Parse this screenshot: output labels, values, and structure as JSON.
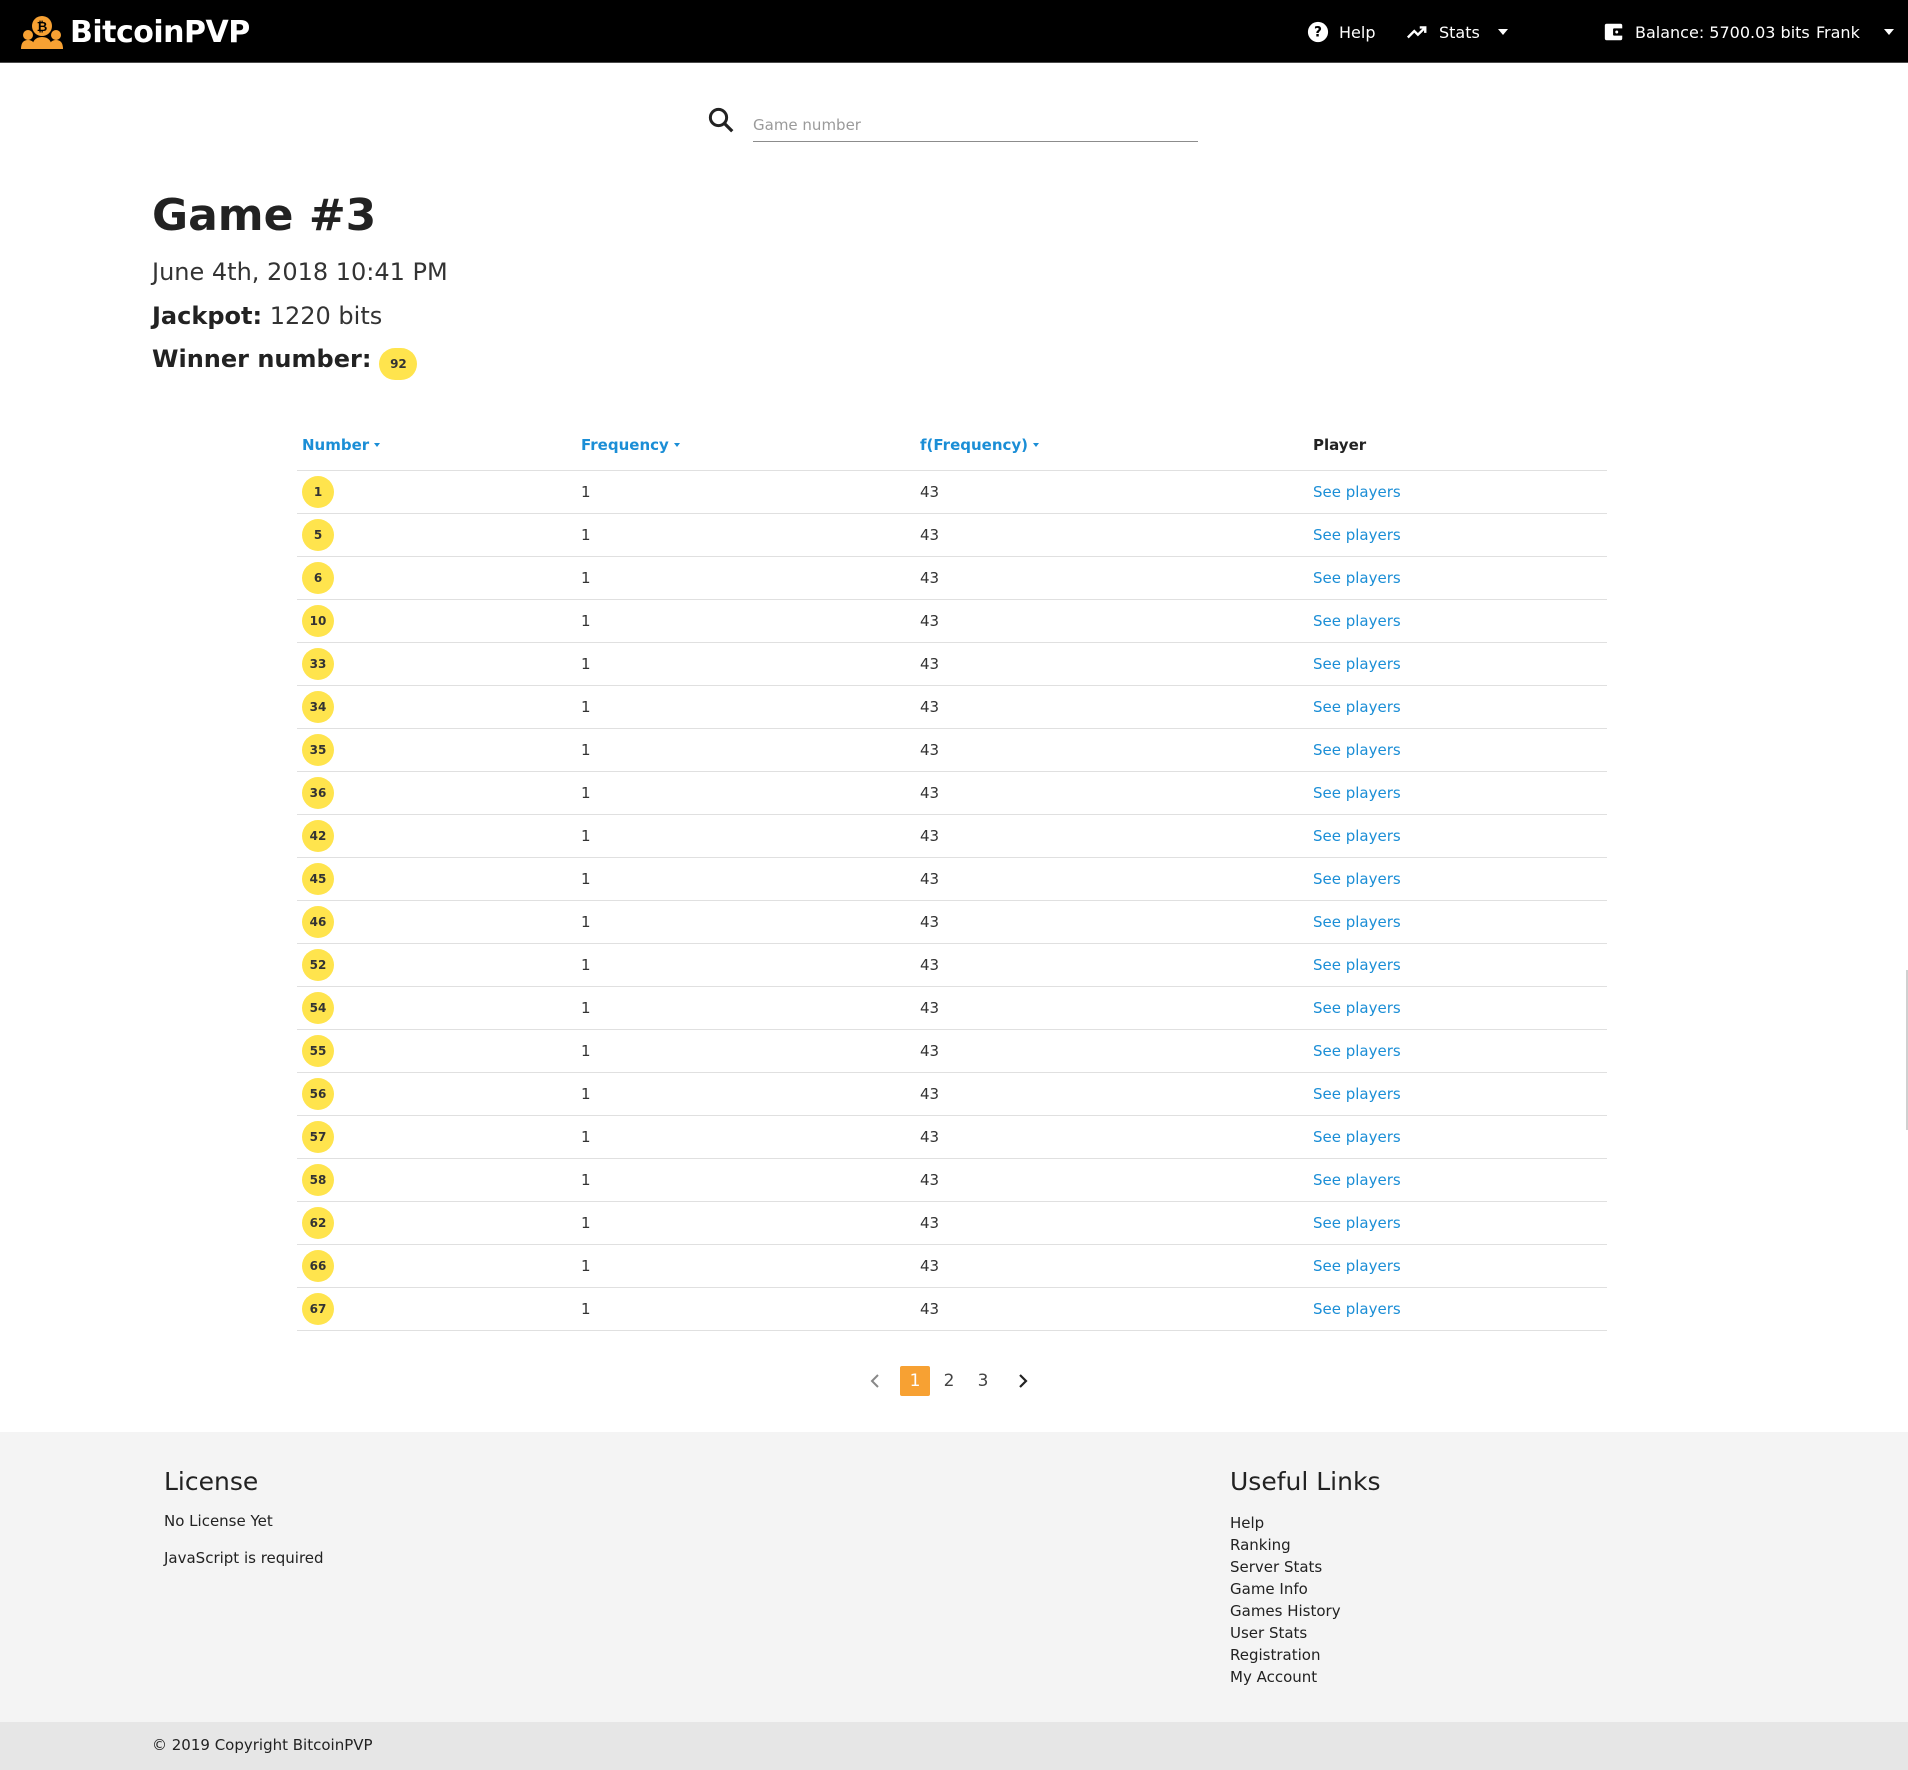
{
  "navbar": {
    "brand": "BitcoinPVP",
    "help_label": "Help",
    "stats_label": "Stats",
    "balance_label": "Balance: 5700.03 bits",
    "user_label": "Frank"
  },
  "search": {
    "placeholder": "Game number"
  },
  "game": {
    "title": "Game #3",
    "date": "June 4th, 2018 10:41 PM",
    "jackpot_label": "Jackpot:",
    "jackpot_value": "1220 bits",
    "winner_label": "Winner number:",
    "winner_number": "92"
  },
  "table": {
    "headers": {
      "number": "Number",
      "frequency": "Frequency",
      "f_frequency": "f(Frequency)",
      "player": "Player"
    },
    "rows": [
      {
        "number": "1",
        "frequency": "1",
        "f_frequency": "43",
        "player": "See players"
      },
      {
        "number": "5",
        "frequency": "1",
        "f_frequency": "43",
        "player": "See players"
      },
      {
        "number": "6",
        "frequency": "1",
        "f_frequency": "43",
        "player": "See players"
      },
      {
        "number": "10",
        "frequency": "1",
        "f_frequency": "43",
        "player": "See players"
      },
      {
        "number": "33",
        "frequency": "1",
        "f_frequency": "43",
        "player": "See players"
      },
      {
        "number": "34",
        "frequency": "1",
        "f_frequency": "43",
        "player": "See players"
      },
      {
        "number": "35",
        "frequency": "1",
        "f_frequency": "43",
        "player": "See players"
      },
      {
        "number": "36",
        "frequency": "1",
        "f_frequency": "43",
        "player": "See players"
      },
      {
        "number": "42",
        "frequency": "1",
        "f_frequency": "43",
        "player": "See players"
      },
      {
        "number": "45",
        "frequency": "1",
        "f_frequency": "43",
        "player": "See players"
      },
      {
        "number": "46",
        "frequency": "1",
        "f_frequency": "43",
        "player": "See players"
      },
      {
        "number": "52",
        "frequency": "1",
        "f_frequency": "43",
        "player": "See players"
      },
      {
        "number": "54",
        "frequency": "1",
        "f_frequency": "43",
        "player": "See players"
      },
      {
        "number": "55",
        "frequency": "1",
        "f_frequency": "43",
        "player": "See players"
      },
      {
        "number": "56",
        "frequency": "1",
        "f_frequency": "43",
        "player": "See players"
      },
      {
        "number": "57",
        "frequency": "1",
        "f_frequency": "43",
        "player": "See players"
      },
      {
        "number": "58",
        "frequency": "1",
        "f_frequency": "43",
        "player": "See players"
      },
      {
        "number": "62",
        "frequency": "1",
        "f_frequency": "43",
        "player": "See players"
      },
      {
        "number": "66",
        "frequency": "1",
        "f_frequency": "43",
        "player": "See players"
      },
      {
        "number": "67",
        "frequency": "1",
        "f_frequency": "43",
        "player": "See players"
      }
    ]
  },
  "pagination": {
    "pages": [
      "1",
      "2",
      "3"
    ],
    "active": "1"
  },
  "footer": {
    "license_title": "License",
    "license_line1": "No License Yet",
    "license_line2": "JavaScript is required",
    "links_title": "Useful Links",
    "links": [
      "Help",
      "Ranking",
      "Server Stats",
      "Game Info",
      "Games History",
      "User Stats",
      "Registration",
      "My Account"
    ],
    "copyright": "© 2019 Copyright BitcoinPVP"
  },
  "colors": {
    "navbar_bg": "#000000",
    "link_blue": "#1b8ed6",
    "badge_yellow": "#ffe44d",
    "page_active": "#f7a133",
    "footer_bg": "#f4f4f4"
  },
  "icons": {
    "brand": "bitcoin-players-logo-icon",
    "help": "help-circle-icon",
    "stats": "trending-up-icon",
    "balance": "wallet-icon",
    "search": "search-icon",
    "prev": "chevron-left-icon",
    "next": "chevron-right-icon"
  }
}
